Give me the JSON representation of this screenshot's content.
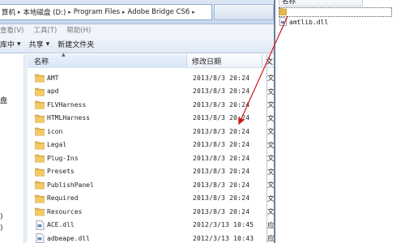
{
  "address": {
    "segments": [
      "算机",
      "本地磁盘 (D:)",
      "Program Files",
      "Adobe Bridge CS6"
    ]
  },
  "menu": [
    "查看(V)",
    "工具(T)",
    "帮助(H)"
  ],
  "toolbar": {
    "organize": "库中",
    "share": "共享",
    "new_folder": "新建文件夹"
  },
  "nav": {
    "item1": "盘",
    "item2": ")",
    "item3": ")"
  },
  "columns": {
    "name": "名称",
    "date": "修改日期",
    "type": "文"
  },
  "files": [
    {
      "name": "AMT",
      "date": "2013/8/3 20:24",
      "type": "文",
      "kind": "folder"
    },
    {
      "name": "apd",
      "date": "2013/8/3 20:24",
      "type": "文",
      "kind": "folder"
    },
    {
      "name": "FLVHarness",
      "date": "2013/8/3 20:24",
      "type": "文",
      "kind": "folder"
    },
    {
      "name": "HTMLHarness",
      "date": "2013/8/3 20:24",
      "type": "文",
      "kind": "folder"
    },
    {
      "name": "icon",
      "date": "2013/8/3 20:24",
      "type": "文",
      "kind": "folder"
    },
    {
      "name": "Legal",
      "date": "2013/8/3 20:24",
      "type": "文",
      "kind": "folder"
    },
    {
      "name": "Plug-Ins",
      "date": "2013/8/3 20:24",
      "type": "文",
      "kind": "folder"
    },
    {
      "name": "Presets",
      "date": "2013/8/3 20:24",
      "type": "文",
      "kind": "folder"
    },
    {
      "name": "PublishPanel",
      "date": "2013/8/3 20:24",
      "type": "文",
      "kind": "folder"
    },
    {
      "name": "Required",
      "date": "2013/8/3 20:24",
      "type": "文",
      "kind": "folder"
    },
    {
      "name": "Resources",
      "date": "2013/8/3 20:24",
      "type": "文",
      "kind": "folder"
    },
    {
      "name": "ACE.dll",
      "date": "2012/3/13 10:45",
      "type": "应",
      "kind": "dll"
    },
    {
      "name": "adbeape.dll",
      "date": "2012/3/13 10:43",
      "type": "应",
      "kind": "dll"
    }
  ],
  "right_pane": {
    "header": "名称",
    "file": "amtlib.dll"
  },
  "colors": {
    "arrow": "#d01818",
    "folder": "#e8b84a",
    "header_bg": "#d7e6f6"
  }
}
